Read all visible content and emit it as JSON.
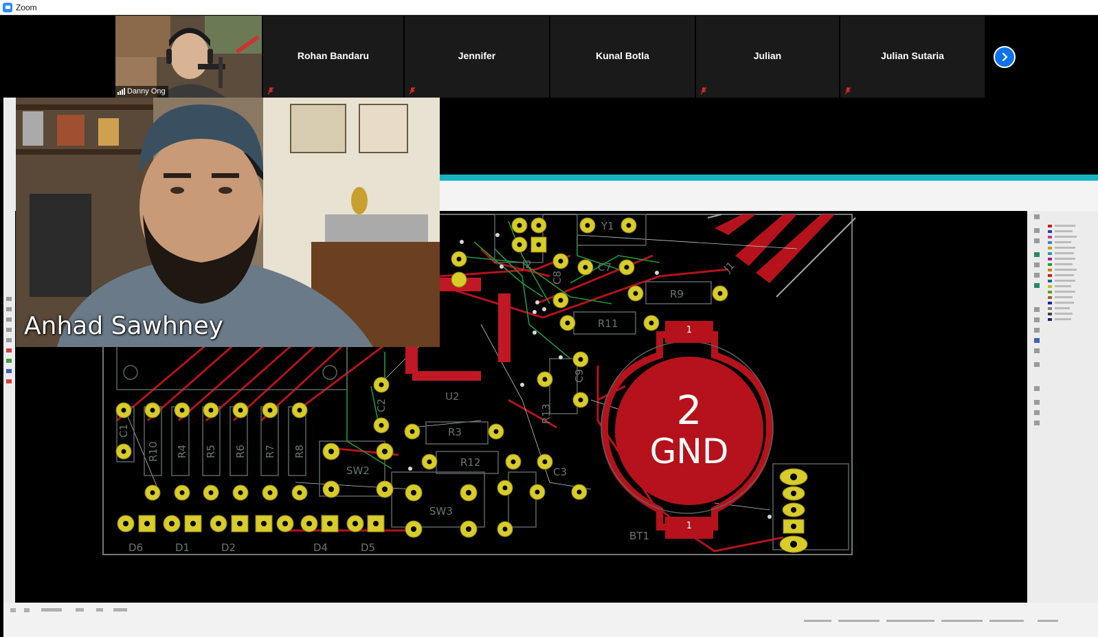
{
  "window": {
    "title": "Zoom"
  },
  "participants": [
    {
      "name": "Danny Ong",
      "video": true
    },
    {
      "name": "Rohan Bandaru",
      "muted": true
    },
    {
      "name": "Jennifer",
      "muted": true
    },
    {
      "name": "Kunal Botla",
      "muted": false
    },
    {
      "name": "Julian",
      "muted": true
    },
    {
      "name": "Julian Sutaria",
      "muted": true
    }
  ],
  "speaker": {
    "name": "Anhad Sawhney"
  },
  "pcb": {
    "big_pad_number": "2",
    "big_pad_net": "GND",
    "labels": [
      "Y1",
      "J2",
      "C7",
      "C8",
      "R9",
      "R11",
      "J1",
      "C9",
      "R13",
      "U2",
      "C2",
      "R3",
      "R12",
      "SW2",
      "C3",
      "SW3",
      "C1",
      "R10",
      "R4",
      "R5",
      "R6",
      "R7",
      "R8",
      "D6",
      "D1",
      "D2",
      "D4",
      "D5",
      "BT1",
      "1"
    ]
  },
  "colors": {
    "zoom_blue": "#0e72ed",
    "pcb_red": "#b5121b",
    "pad_yellow": "#d8cc2a",
    "kicad_teal": "#17b3c4"
  }
}
